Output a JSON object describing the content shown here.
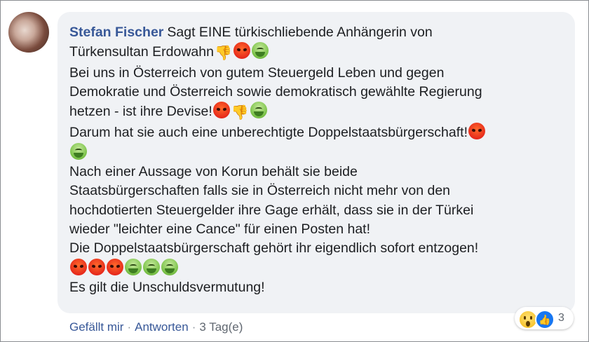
{
  "comment": {
    "author": "Stefan Fischer",
    "lines": [
      "Sagt EINE türkischliebende Anhängerin von",
      "Türkensultan Erdowahn",
      "Bei uns in Österreich von gutem Steuergeld Leben und gegen",
      "Demokratie und Österreich sowie demokratisch gewählte Regierung",
      "hetzen - ist ihre Devise!",
      "Darum hat sie auch eine unberechtigte Doppelstaatsbürgerschaft!",
      "Nach einer Aussage von Korun behält sie beide",
      "Staatsbürgerschaften falls sie in Österreich nicht mehr von den",
      "hochdotierten Steuergelder ihre Gage erhält, dass sie in der Türkei",
      "wieder \"leichter eine Cance\" für einen Posten hat!",
      "Die Doppelstaatsbürgerschaft gehört ihr eigendlich sofort entzogen!",
      "Es gilt die Unschuldsvermutung!"
    ],
    "icons": {
      "thumbs_down": "👎",
      "angry": "angry-face-icon",
      "sick": "nauseated-face-icon"
    }
  },
  "actions": {
    "like": "Gefällt mir",
    "reply": "Antworten",
    "separator": "·",
    "time": "3 Tag(e)"
  },
  "reactions": {
    "count": "3",
    "like_glyph": "👍"
  }
}
